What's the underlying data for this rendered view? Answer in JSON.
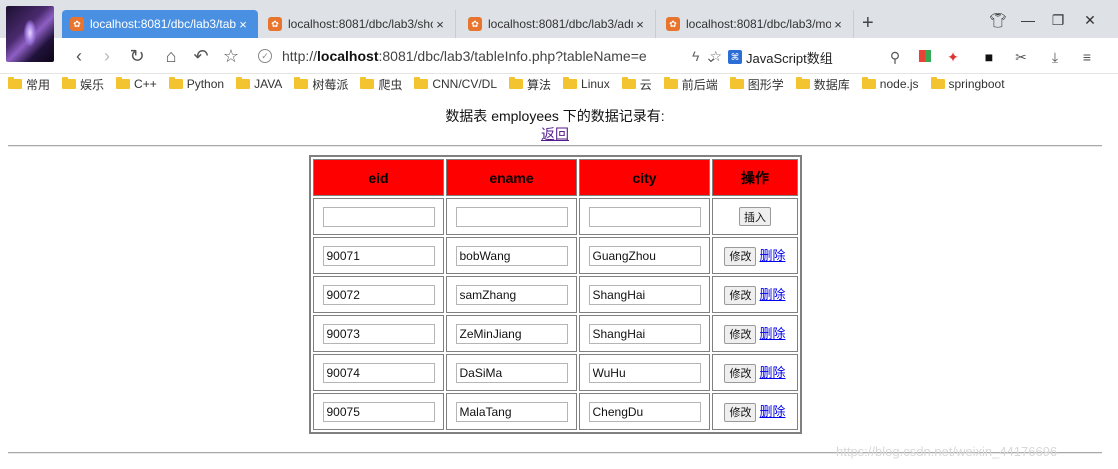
{
  "browser": {
    "tabs": [
      {
        "title": "localhost:8081/dbc/lab3/tabl",
        "active": true
      },
      {
        "title": "localhost:8081/dbc/lab3/sho",
        "active": false
      },
      {
        "title": "localhost:8081/dbc/lab3/adm",
        "active": false
      },
      {
        "title": "localhost:8081/dbc/lab3/mo",
        "active": false
      }
    ],
    "url_prefix": "http://",
    "url_host": "localhost",
    "url_rest": ":8081/dbc/lab3/tableInfo.php?tableName=e",
    "search_text": "JavaScript数组",
    "bookmarks": [
      "常用",
      "娱乐",
      "C++",
      "Python",
      "JAVA",
      "树莓派",
      "爬虫",
      "CNN/CV/DL",
      "算法",
      "Linux",
      "云",
      "前后端",
      "图形学",
      "数据库",
      "node.js",
      "springboot"
    ]
  },
  "page": {
    "title": "数据表 employees 下的数据记录有:",
    "back_link": "返回"
  },
  "table": {
    "headers": {
      "eid": "eid",
      "ename": "ename",
      "city": "city",
      "op": "操作"
    },
    "insert_label": "插入",
    "edit_label": "修改",
    "delete_label": "删除",
    "rows": [
      {
        "eid": "90071",
        "ename": "bobWang",
        "city": "GuangZhou"
      },
      {
        "eid": "90072",
        "ename": "samZhang",
        "city": "ShangHai"
      },
      {
        "eid": "90073",
        "ename": "ZeMinJiang",
        "city": "ShangHai"
      },
      {
        "eid": "90074",
        "ename": "DaSiMa",
        "city": "WuHu"
      },
      {
        "eid": "90075",
        "ename": "MalaTang",
        "city": "ChengDu"
      }
    ]
  },
  "watermark": "https://blog.csdn.net/weixin_44176696",
  "colors": {
    "header_bg": "#ff0000",
    "active_tab": "#4a90e2"
  }
}
